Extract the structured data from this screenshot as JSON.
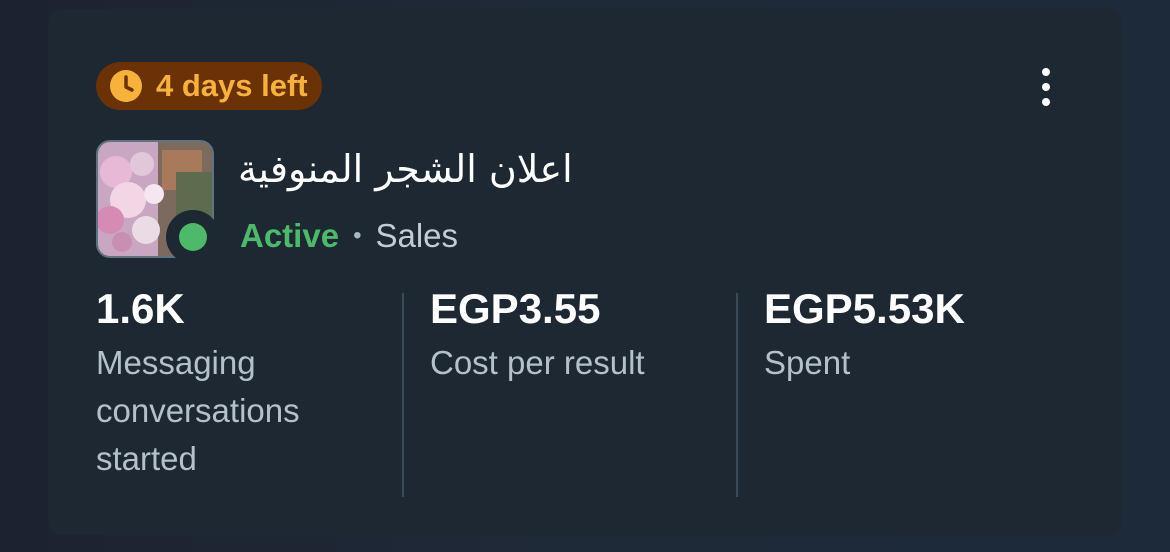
{
  "badge": {
    "text": "4 days left",
    "icon": "clock-icon",
    "color": "#f7b23a",
    "background": "#6b3206"
  },
  "ad": {
    "title": "اعلان الشجر المنوفية",
    "status": "Active",
    "status_color": "#4cba6a",
    "separator": "•",
    "objective": "Sales"
  },
  "metrics": [
    {
      "value": "1.6K",
      "label": "Messaging conversations started"
    },
    {
      "value": "EGP3.55",
      "label": "Cost per result"
    },
    {
      "value": "EGP5.53K",
      "label": "Spent"
    }
  ],
  "menu": {
    "icon": "more-vertical-icon"
  }
}
